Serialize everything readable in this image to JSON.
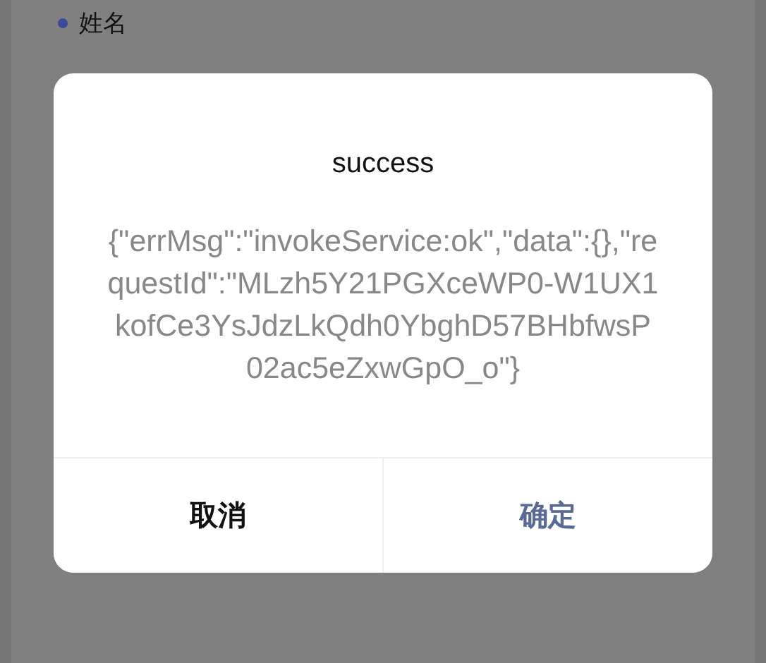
{
  "list_items": [
    {
      "label": "姓名",
      "color": "#3b4a9a"
    }
  ],
  "dialog": {
    "title": "success",
    "message": "{\"errMsg\":\"invokeService:ok\",\"data\":{},\"requestId\":\"MLzh5Y21PGXceWP0-W1UX1kofCe3YsJdzLkQdh0YbghD57BHbfwsP02ac5eZxwGpO_o\"}",
    "buttons": [
      {
        "label": "取消",
        "kind": "cancel"
      },
      {
        "label": "确定",
        "kind": "confirm"
      }
    ]
  }
}
